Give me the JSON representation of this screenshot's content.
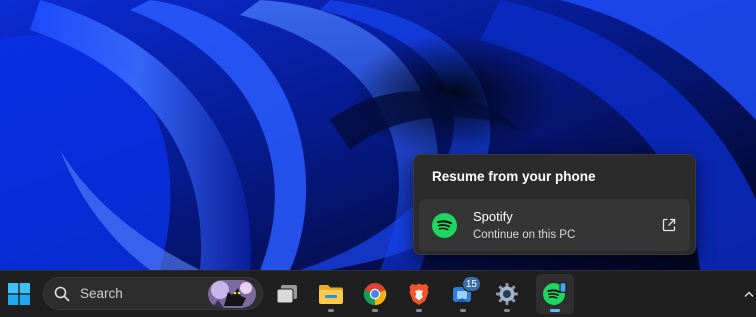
{
  "flyout": {
    "title": "Resume from your phone",
    "app": {
      "name": "Spotify",
      "subtitle": "Continue on this PC",
      "icon": "spotify-icon",
      "action_icon": "open-external-icon"
    }
  },
  "taskbar": {
    "search": {
      "placeholder": "Search"
    },
    "items": [
      {
        "name": "start-button",
        "icon": "windows-logo-icon"
      },
      {
        "name": "task-view-button",
        "icon": "task-view-icon"
      },
      {
        "name": "file-explorer-button",
        "icon": "folder-icon"
      },
      {
        "name": "chrome-button",
        "icon": "chrome-icon"
      },
      {
        "name": "brave-button",
        "icon": "brave-icon"
      },
      {
        "name": "teams-button",
        "icon": "teams-icon",
        "badge": "15"
      },
      {
        "name": "settings-button",
        "icon": "gear-icon"
      },
      {
        "name": "spotify-taskbar-button",
        "icon": "spotify-icon"
      }
    ],
    "tray": {
      "icon": "chevron-up-icon"
    }
  },
  "colors": {
    "accent": "#6ab7ff",
    "spotify_green": "#1ed760",
    "taskbar_bg": "#1f1f1f",
    "flyout_bg": "#2b2b2b"
  }
}
